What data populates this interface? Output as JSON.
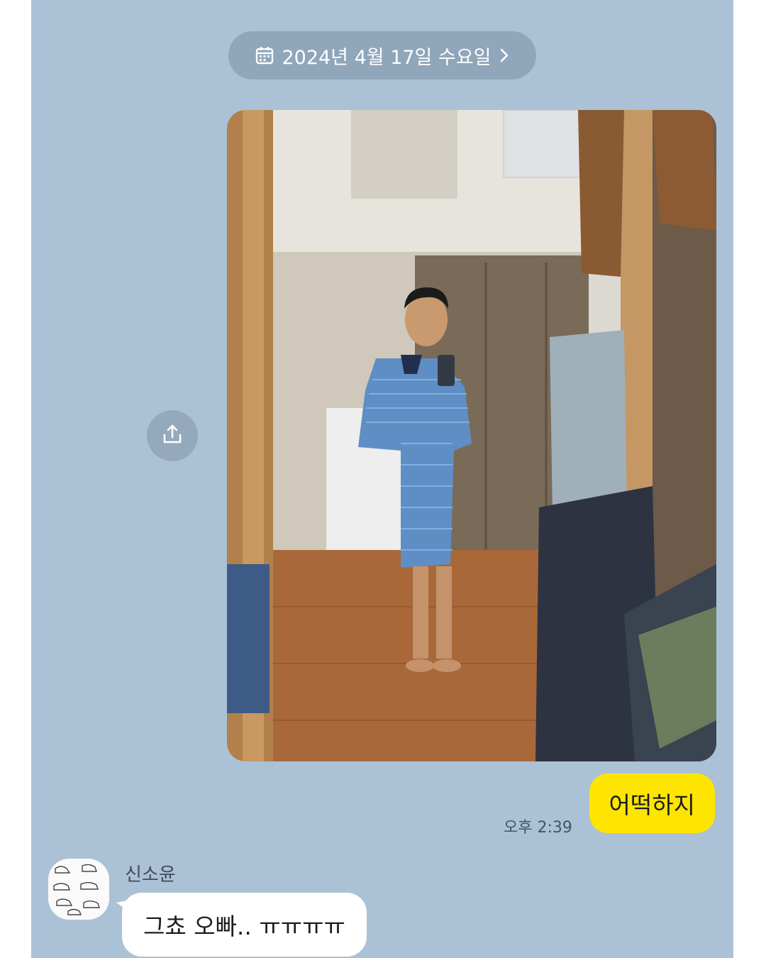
{
  "header": {
    "date_label": "2024년 4월 17일 수요일"
  },
  "messages": {
    "outgoing": {
      "text": "어떡하지",
      "time": "오후 2:39"
    },
    "incoming": {
      "sender": "신소윤",
      "text": "그쵸 오빠.. ㅠㅠㅠㅠ"
    }
  },
  "icons": {
    "date": "calendar-icon",
    "chevron": "chevron-right-icon",
    "share": "share-upload-icon"
  },
  "colors": {
    "chat_background": "#abc1d6",
    "date_pill": "#8fa6bb",
    "my_bubble": "#fee500",
    "other_bubble": "#ffffff"
  }
}
